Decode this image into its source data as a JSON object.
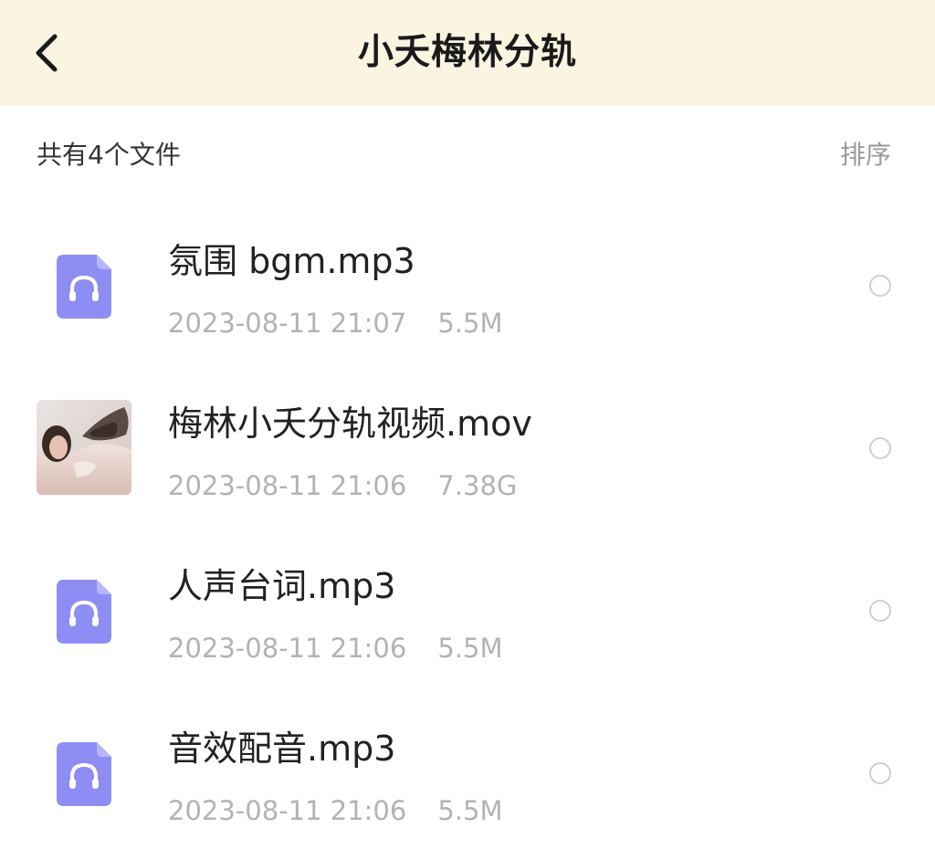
{
  "header": {
    "title": "小夭梅林分轨",
    "back_icon": "chevron-left-icon"
  },
  "summary": {
    "count_text": "共有4个文件",
    "sort_label": "排序"
  },
  "files": [
    {
      "name": "氛围 bgm.mp3",
      "date": "2023-08-11 21:07",
      "size": "5.5M",
      "icon": "headphones-file-icon",
      "selected": false
    },
    {
      "name": "梅林小夭分轨视频.mov",
      "date": "2023-08-11 21:06",
      "size": "7.38G",
      "icon": "video-thumbnail",
      "selected": false
    },
    {
      "name": "人声台词.mp3",
      "date": "2023-08-11 21:06",
      "size": "5.5M",
      "icon": "headphones-file-icon",
      "selected": false
    },
    {
      "name": "音效配音.mp3",
      "date": "2023-08-11 21:06",
      "size": "5.5M",
      "icon": "headphones-file-icon",
      "selected": false
    }
  ],
  "colors": {
    "header_bg": "#fbf4e1",
    "audio_icon": "#8e8df4",
    "meta_text": "#b3b3b3",
    "radio_border": "#cfcfcf"
  }
}
